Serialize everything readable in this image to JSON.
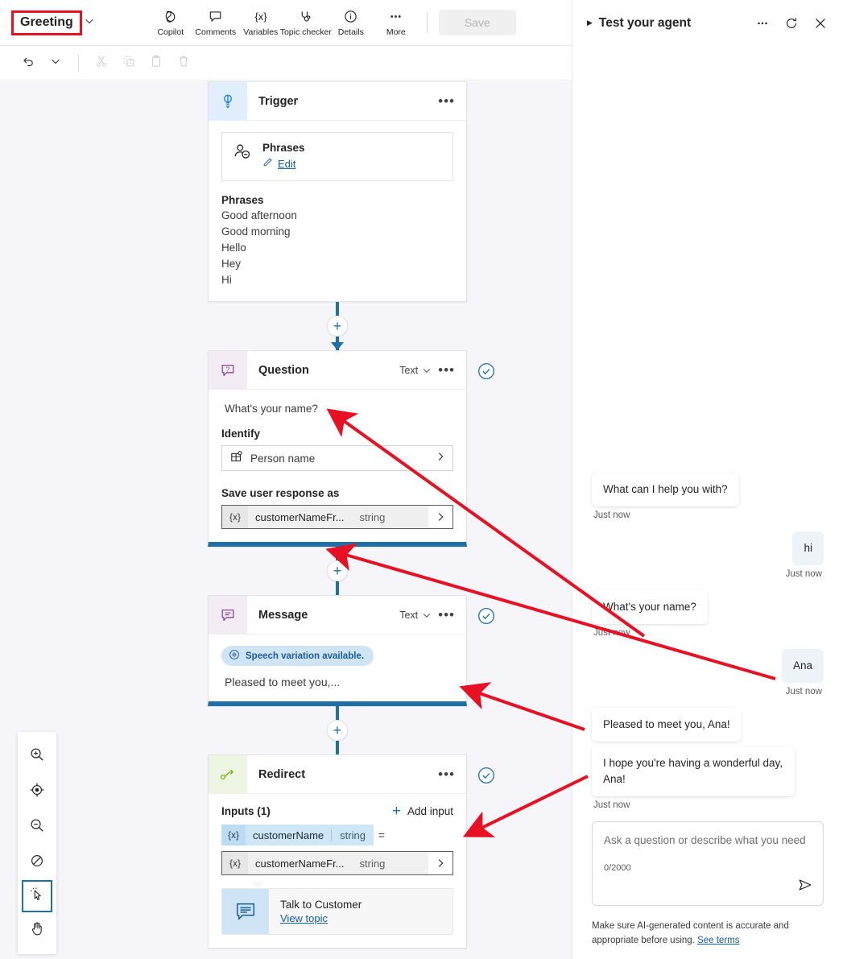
{
  "toolbar": {
    "topic_title": "Greeting",
    "items": [
      {
        "label": "Copilot",
        "icon": "copilot-icon"
      },
      {
        "label": "Comments",
        "icon": "comment-icon"
      },
      {
        "label": "Variables",
        "icon": "variables-icon"
      },
      {
        "label": "Topic checker",
        "icon": "topic-checker-icon"
      },
      {
        "label": "Details",
        "icon": "info-icon"
      },
      {
        "label": "More",
        "icon": "more-icon"
      }
    ],
    "save_label": "Save"
  },
  "editbar": {
    "undo": "undo-icon",
    "undo_chevron": "chevron-down-icon",
    "cut": "cut-icon",
    "copy": "copy-icon",
    "paste": "paste-icon",
    "delete": "trash-icon"
  },
  "canvas": {
    "nodes": {
      "trigger": {
        "title": "Trigger",
        "card": {
          "title": "Phrases",
          "edit_label": "Edit"
        },
        "phrases_heading": "Phrases",
        "phrases": [
          "Good afternoon",
          "Good morning",
          "Hello",
          "Hey",
          "Hi"
        ]
      },
      "question": {
        "title": "Question",
        "type": "Text",
        "question_text": "What's your name?",
        "identify_label": "Identify",
        "identify_value": "Person name",
        "save_label": "Save user response as",
        "variable": {
          "prefix": "{x}",
          "name": "customerNameFr...",
          "type": "string"
        }
      },
      "message": {
        "title": "Message",
        "type": "Text",
        "speech_badge": "Speech variation available.",
        "text": "Pleased to meet you,..."
      },
      "redirect": {
        "title": "Redirect",
        "inputs_label": "Inputs (1)",
        "add_input_label": "Add input",
        "input_param": {
          "prefix": "{x}",
          "name": "customerName",
          "type": "string",
          "equals": "="
        },
        "input_value": {
          "prefix": "{x}",
          "name": "customerNameFr...",
          "type": "string"
        },
        "target_topic": "Talk to Customer",
        "target_link": "View topic"
      }
    },
    "tools": [
      {
        "name": "zoom-in-icon"
      },
      {
        "name": "fit-to-view-icon"
      },
      {
        "name": "zoom-out-icon"
      },
      {
        "name": "reset-zoom-icon"
      },
      {
        "name": "pointer-select-icon",
        "active": true
      },
      {
        "name": "pan-hand-icon"
      }
    ],
    "accent_blue": "#1f6fa8",
    "background": "#f6f6fa",
    "annotation_color": "#e81123"
  },
  "test_panel": {
    "title": "Test your agent",
    "messages": [
      {
        "from": "bot",
        "text": "What can I help you with?",
        "time": "Just now"
      },
      {
        "from": "user",
        "text": "hi",
        "time": "Just now"
      },
      {
        "from": "bot",
        "text": "What's your name?",
        "time": "Just now"
      },
      {
        "from": "user",
        "text": "Ana",
        "time": "Just now"
      },
      {
        "from": "bot",
        "text": "Pleased to meet you, Ana!",
        "time": ""
      },
      {
        "from": "bot",
        "text": "I hope you're having a wonderful day, Ana!",
        "time": "Just now"
      }
    ],
    "composer": {
      "placeholder": "Ask a question or describe what you need",
      "counter": "0/2000"
    },
    "disclaimer": "Make sure AI-generated content is accurate and appropriate before using.",
    "disclaimer_link": "See terms"
  }
}
